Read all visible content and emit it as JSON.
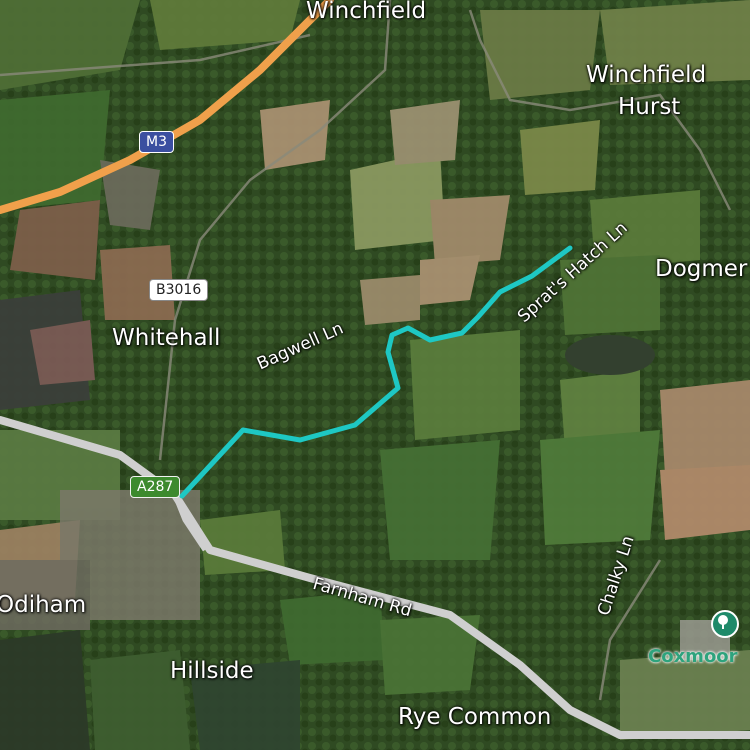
{
  "places": {
    "winchfield": "Winchfield",
    "winchfield_hurst_1": "Winchfield",
    "winchfield_hurst_2": "Hurst",
    "dogmersfield": "Dogmer",
    "whitehall": "Whitehall",
    "odiham": "Odiham",
    "hillside": "Hillside",
    "rye_common": "Rye Common"
  },
  "roads": {
    "m3": "M3",
    "b3016": "B3016",
    "a287": "A287",
    "bagwell": "Bagwell Ln",
    "sprats_hatch": "Sprat's Hatch Ln",
    "farnham": "Farnham Rd",
    "chalky": "Chalky Ln"
  },
  "poi": {
    "coxmoor": "Coxmoor",
    "icon": "tree-icon"
  },
  "colors": {
    "route": "#1ec8c4",
    "motorway": "#f0a04b",
    "a_road": "#cfcfcf",
    "poi": "#2ea37d"
  }
}
